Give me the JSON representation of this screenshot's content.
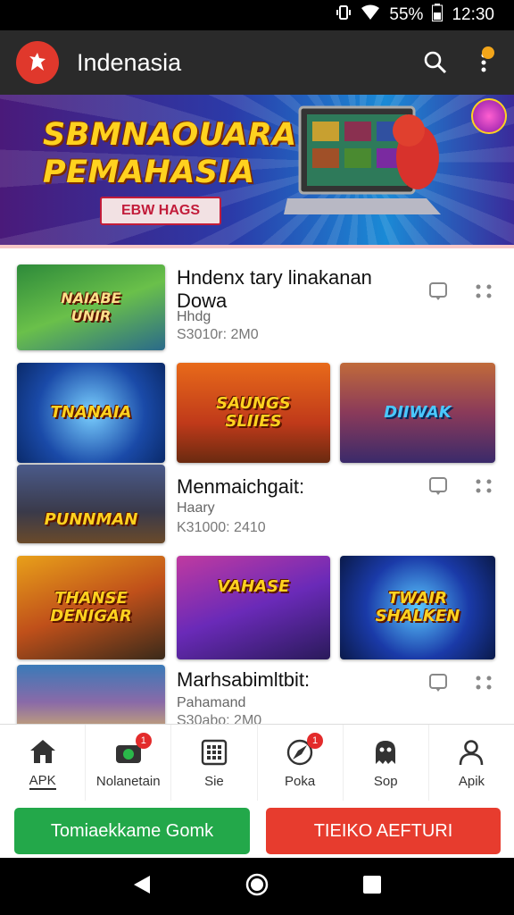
{
  "status_bar": {
    "battery": "55%",
    "time": "12:30"
  },
  "app_bar": {
    "title": "Indenasia",
    "icons": [
      "logo-icon",
      "search-icon",
      "more-vert-icon"
    ]
  },
  "banner": {
    "title": "SBMNAOUARA\nPEMAHASIA",
    "button_label": "EBW HAGS"
  },
  "entries": [
    {
      "title": "Hndenx tary linakanan\nDowa",
      "subtitle": "Hhdg",
      "meta": "S3010r: 2M0"
    },
    {
      "title": "Menmaichgait:",
      "subtitle": "Haary",
      "meta": "K31000: 2410"
    },
    {
      "title": "Marhsabimltbit:",
      "subtitle": "Pahamand",
      "meta": "S30abo: 2M0"
    }
  ],
  "thumbnails": [
    {
      "label": "NAIABE\nUNIR"
    },
    {
      "label": "TNANAIA"
    },
    {
      "label": "SAUNGS\nSLIIES"
    },
    {
      "label": "DIIWAK"
    },
    {
      "label": "PUNNMAN"
    },
    {
      "label": "THANSE\nDENIGAR"
    },
    {
      "label": "VAHASE"
    },
    {
      "label": "TWAIR\nSHALKEN"
    }
  ],
  "bottom_nav": [
    {
      "label": "APK",
      "icon": "home-icon",
      "active": true
    },
    {
      "label": "Nolanetain",
      "icon": "camera-icon",
      "badge": "1"
    },
    {
      "label": "Sie",
      "icon": "grid-icon"
    },
    {
      "label": "Poka",
      "icon": "compass-icon",
      "badge": "1"
    },
    {
      "label": "Sop",
      "icon": "ghost-icon"
    },
    {
      "label": "Apik",
      "icon": "person-icon"
    }
  ],
  "actions": {
    "primary_label": "Tomiaekkame Gomk",
    "secondary_label": "TIEIKO AEFTURI"
  },
  "colors": {
    "app_bar": "#2a2a2a",
    "primary": "#23a84a",
    "secondary": "#e73c2e",
    "banner_text": "#ffd21f"
  }
}
